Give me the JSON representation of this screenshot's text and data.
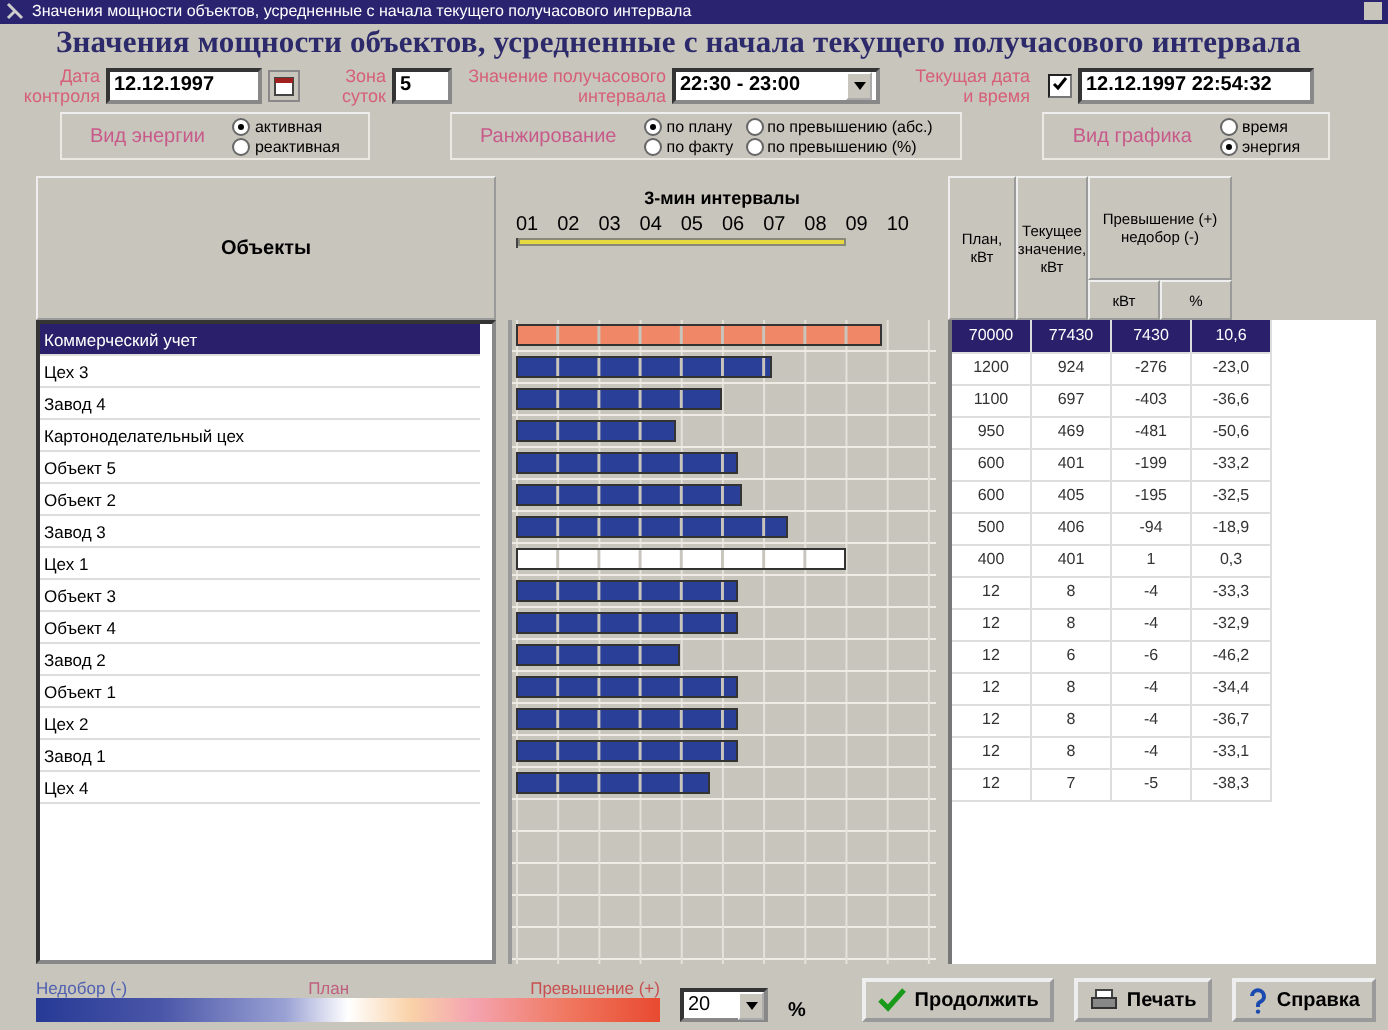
{
  "window": {
    "title": "Значения мощности объектов, усредненные с начала текущего получасового интервала"
  },
  "heading": "Значения мощности объектов, усредненные с начала текущего получасового интервала",
  "controls": {
    "date_label": "Дата контроля",
    "date": "12.12.1997",
    "zone_label": "Зона суток",
    "zone": "5",
    "interval_label": "Значение получасового интервала",
    "interval": "22:30 - 23:00",
    "now_label": "Текущая дата и время",
    "now_checked": true,
    "now": "12.12.1997 22:54:32"
  },
  "groups": [
    {
      "label": "Вид энергии",
      "options": [
        {
          "label": "активная",
          "selected": true
        },
        {
          "label": "реактивная",
          "selected": false
        }
      ]
    },
    {
      "label": "Ранжирование",
      "options": [
        {
          "label": "по плану",
          "selected": true
        },
        {
          "label": "по превышению (абс.)",
          "selected": false
        },
        {
          "label": "по факту",
          "selected": false
        },
        {
          "label": "по превышению (%)",
          "selected": false
        }
      ]
    },
    {
      "label": "Вид графика",
      "options": [
        {
          "label": "время",
          "selected": false
        },
        {
          "label": "энергия",
          "selected": true
        }
      ]
    }
  ],
  "columns": {
    "objects": "Объекты",
    "chart": "3-мин интервалы",
    "ticks": [
      "01",
      "02",
      "03",
      "04",
      "05",
      "06",
      "07",
      "08",
      "09",
      "10"
    ],
    "elapsed": {
      "level": 0.8
    },
    "plan": "План, кВт",
    "current": "Текущее значение, кВт",
    "excess": "Превышение (+) недобор (-)",
    "excess_kw": "кВт",
    "excess_pct": "%"
  },
  "rows": [
    {
      "name": "Коммерческий учет",
      "plan": "70000",
      "current": "77430",
      "diff": "7430",
      "pct": "10,6",
      "level": 0.89,
      "color": "#f08868",
      "selected": true
    },
    {
      "name": "Цех 3",
      "plan": "1200",
      "current": "924",
      "diff": "-276",
      "pct": "-23,0",
      "level": 0.62,
      "color": "#2a3f98",
      "selected": false
    },
    {
      "name": "Завод 4",
      "plan": "1100",
      "current": "697",
      "diff": "-403",
      "pct": "-36,6",
      "level": 0.5,
      "color": "#2a3f98",
      "selected": false
    },
    {
      "name": "Картоноделательный цех",
      "plan": "950",
      "current": "469",
      "diff": "-481",
      "pct": "-50,6",
      "level": 0.39,
      "color": "#2a3f98",
      "selected": false
    },
    {
      "name": "Объект 5",
      "plan": "600",
      "current": "401",
      "diff": "-199",
      "pct": "-33,2",
      "level": 0.54,
      "color": "#2a3f98",
      "selected": false
    },
    {
      "name": "Объект 2",
      "plan": "600",
      "current": "405",
      "diff": "-195",
      "pct": "-32,5",
      "level": 0.55,
      "color": "#2a3f98",
      "selected": false
    },
    {
      "name": "Завод 3",
      "plan": "500",
      "current": "406",
      "diff": "-94",
      "pct": "-18,9",
      "level": 0.66,
      "color": "#2a3f98",
      "selected": false
    },
    {
      "name": "Цех 1",
      "plan": "400",
      "current": "401",
      "diff": "1",
      "pct": "0,3",
      "level": 0.8,
      "color": "#ffffff",
      "selected": false
    },
    {
      "name": "Объект 3",
      "plan": "12",
      "current": "8",
      "diff": "-4",
      "pct": "-33,3",
      "level": 0.54,
      "color": "#2a3f98",
      "selected": false
    },
    {
      "name": "Объект 4",
      "plan": "12",
      "current": "8",
      "diff": "-4",
      "pct": "-32,9",
      "level": 0.54,
      "color": "#2a3f98",
      "selected": false
    },
    {
      "name": "Завод 2",
      "plan": "12",
      "current": "6",
      "diff": "-6",
      "pct": "-46,2",
      "level": 0.4,
      "color": "#2a3f98",
      "selected": false
    },
    {
      "name": "Объект 1",
      "plan": "12",
      "current": "8",
      "diff": "-4",
      "pct": "-34,4",
      "level": 0.54,
      "color": "#2a3f98",
      "selected": false
    },
    {
      "name": "Цех 2",
      "plan": "12",
      "current": "8",
      "diff": "-4",
      "pct": "-36,7",
      "level": 0.54,
      "color": "#2a3f98",
      "selected": false
    },
    {
      "name": "Завод 1",
      "plan": "12",
      "current": "8",
      "diff": "-4",
      "pct": "-33,1",
      "level": 0.54,
      "color": "#2a3f98",
      "selected": false
    },
    {
      "name": "Цех 4",
      "plan": "12",
      "current": "7",
      "diff": "-5",
      "pct": "-38,3",
      "level": 0.47,
      "color": "#2a3f98",
      "selected": false
    }
  ],
  "legend": {
    "under": "Недобор (-)",
    "plan": "План",
    "over": "Превышение (+)",
    "threshold": "20",
    "unit": "%"
  },
  "buttons": [
    {
      "kind": "ok",
      "label": "Продолжить"
    },
    {
      "kind": "print",
      "label": "Печать"
    },
    {
      "kind": "help",
      "label": "Справка"
    }
  ]
}
